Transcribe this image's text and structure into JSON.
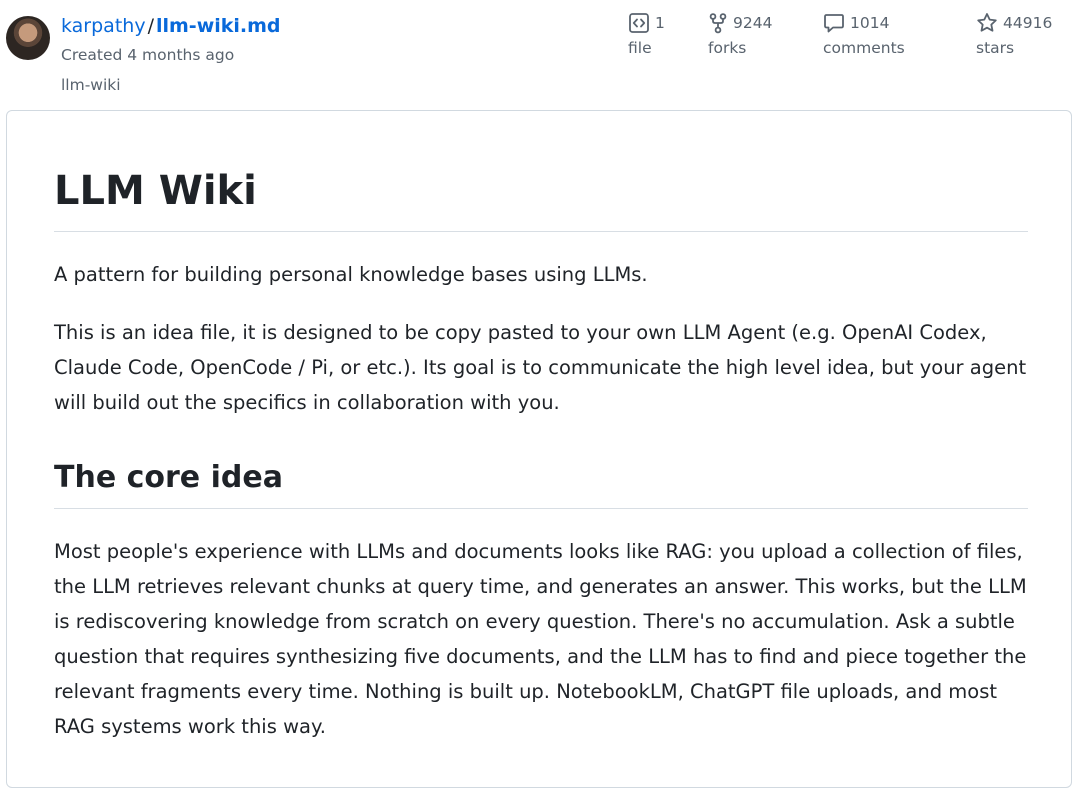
{
  "header": {
    "owner": "karpathy",
    "separator": "/",
    "filename": "llm-wiki.md",
    "created": "Created 4 months ago",
    "description": "llm-wiki",
    "stats": {
      "file": {
        "count": "1",
        "label": "file",
        "icon": "code-square-icon"
      },
      "forks": {
        "count": "9244",
        "label": "forks",
        "icon": "fork-icon"
      },
      "comments": {
        "count": "1014",
        "label": "comments",
        "icon": "comment-icon"
      },
      "stars": {
        "count": "44916",
        "label": "stars",
        "icon": "star-icon"
      }
    }
  },
  "document": {
    "title": "LLM Wiki",
    "tagline": "A pattern for building personal knowledge bases using LLMs.",
    "intro": "This is an idea file, it is designed to be copy pasted to your own LLM Agent (e.g. OpenAI Codex, Claude Code, OpenCode / Pi, or etc.). Its goal is to communicate the high level idea, but your agent will build out the specifics in collaboration with you.",
    "section_heading": "The core idea",
    "section_body": "Most people's experience with LLMs and documents looks like RAG: you upload a collection of files, the LLM retrieves relevant chunks at query time, and generates an answer. This works, but the LLM is rediscovering knowledge from scratch on every question. There's no accumulation. Ask a subtle question that requires synthesizing five documents, and the LLM has to find and piece together the relevant fragments every time. Nothing is built up. NotebookLM, ChatGPT file uploads, and most RAG systems work this way."
  },
  "colors": {
    "link": "#0969da",
    "text": "#1f2328",
    "muted": "#59636e",
    "border": "#d1d9e0"
  }
}
